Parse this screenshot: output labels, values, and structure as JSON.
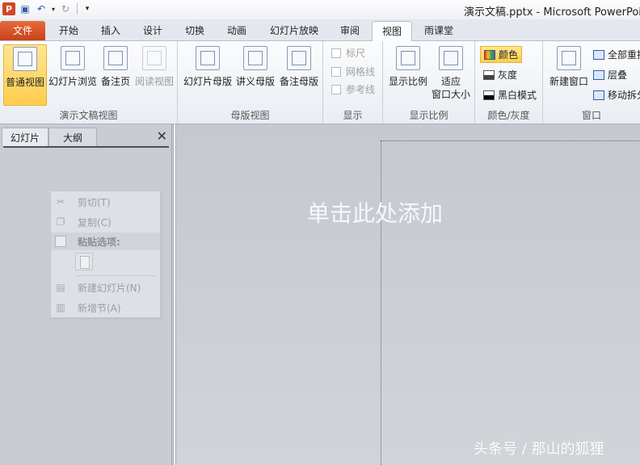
{
  "window": {
    "title": "演示文稿.pptx - Microsoft PowerPoint"
  },
  "qat": {
    "app_icon": "P"
  },
  "tabs": [
    {
      "label": "文件"
    },
    {
      "label": "开始"
    },
    {
      "label": "插入"
    },
    {
      "label": "设计"
    },
    {
      "label": "切换"
    },
    {
      "label": "动画"
    },
    {
      "label": "幻灯片放映"
    },
    {
      "label": "审阅"
    },
    {
      "label": "视图"
    },
    {
      "label": "雨课堂"
    }
  ],
  "ribbon": {
    "presentation_views": {
      "label": "演示文稿视图",
      "normal": "普通视图",
      "slide_sorter": "幻灯片浏览",
      "notes_page": "备注页",
      "reading_view": "阅读视图"
    },
    "master_views": {
      "label": "母版视图",
      "slide_master": "幻灯片母版",
      "handout_master": "讲义母版",
      "notes_master": "备注母版"
    },
    "show": {
      "label": "显示",
      "ruler": "标尺",
      "gridlines": "网格线",
      "guides": "参考线"
    },
    "zoom": {
      "label": "显示比例",
      "zoom": "显示比例",
      "fit_line1": "适应",
      "fit_line2": "窗口大小"
    },
    "color_grayscale": {
      "label": "颜色/灰度",
      "color": "颜色",
      "grayscale": "灰度",
      "black_white": "黑白模式"
    },
    "window": {
      "label": "窗口",
      "new_window": "新建窗口",
      "arrange_all": "全部重排",
      "cascade": "层叠",
      "move_split": "移动拆分"
    }
  },
  "left_pane": {
    "tab_slides": "幻灯片",
    "tab_outline": "大纲",
    "close": "✕"
  },
  "context_menu": {
    "cut": "剪切(T)",
    "copy": "复制(C)",
    "paste_options": "粘贴选项:",
    "new_slide": "新建幻灯片(N)",
    "new_section": "新增节(A)"
  },
  "slide": {
    "placeholder": "单击此处添加"
  },
  "watermark": "头条号 / 那山的狐狸",
  "colors": {
    "file_tab": "#d24726",
    "selected": "#ffcd4d"
  }
}
